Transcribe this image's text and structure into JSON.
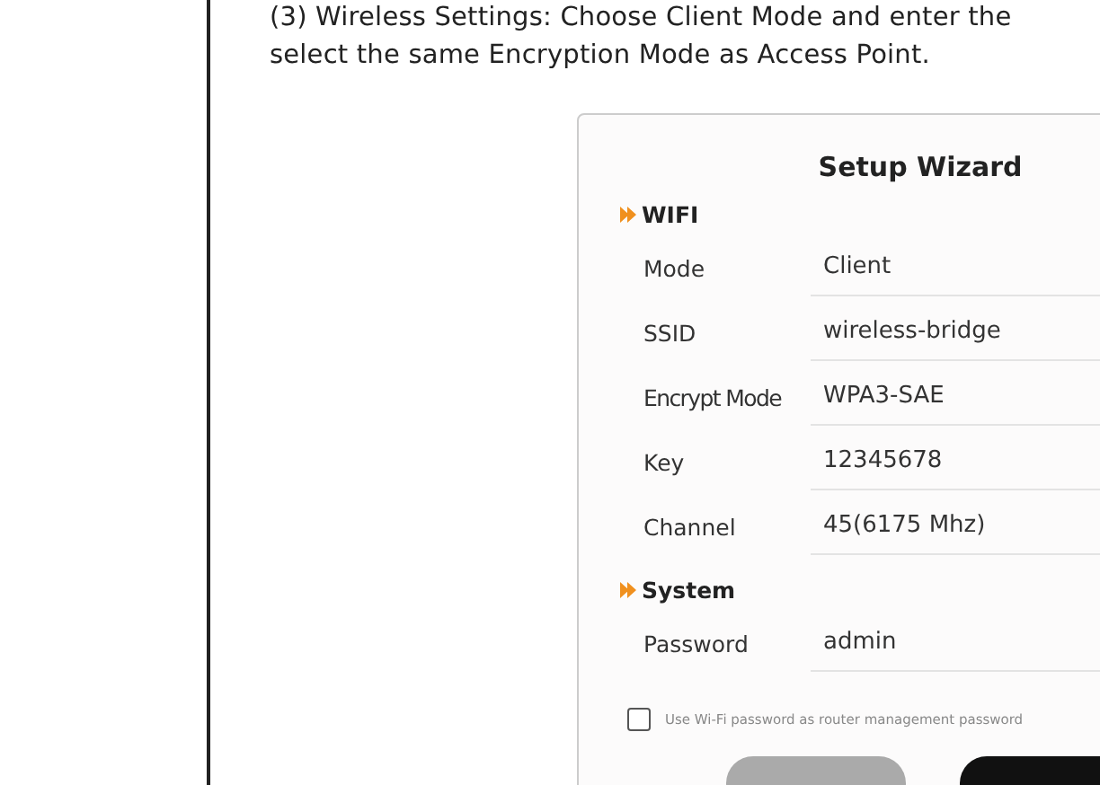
{
  "instructions": "(3) Wireless Settings: Choose Client Mode and enter the\nselect the same Encryption Mode as Access Point.",
  "wizard": {
    "title": "Setup Wizard",
    "sections": [
      {
        "heading": "WIFI",
        "fields": [
          {
            "label": "Mode",
            "value": "Client"
          },
          {
            "label": "SSID",
            "value": "wireless-bridge"
          },
          {
            "label": "Encrypt Mode",
            "value": "WPA3-SAE"
          },
          {
            "label": "Key",
            "value": "12345678"
          },
          {
            "label": "Channel",
            "value": "45(6175 Mhz)"
          }
        ]
      },
      {
        "heading": "System",
        "fields": [
          {
            "label": "Password",
            "value": "admin"
          }
        ]
      }
    ],
    "checkbox": {
      "label": "Use Wi-Fi password as router management password",
      "checked": false
    },
    "buttons": [
      {
        "kind": "secondary"
      },
      {
        "kind": "primary"
      }
    ]
  }
}
